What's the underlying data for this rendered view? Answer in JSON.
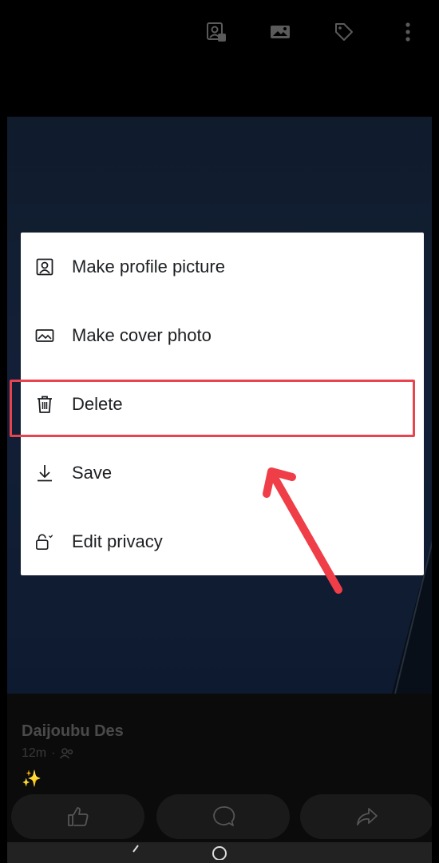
{
  "topbar": {
    "icons": [
      "profile-picture-icon",
      "cover-photo-icon",
      "tag-icon",
      "more-options-icon"
    ]
  },
  "menu": {
    "items": [
      {
        "label": "Make profile picture",
        "icon": "profile-frame-icon"
      },
      {
        "label": "Make cover photo",
        "icon": "landscape-image-icon"
      },
      {
        "label": "Delete",
        "icon": "trash-icon"
      },
      {
        "label": "Save",
        "icon": "download-icon"
      },
      {
        "label": "Edit privacy",
        "icon": "lock-icon"
      }
    ]
  },
  "post": {
    "author": "Daijoubu Des",
    "time": "12m",
    "separator": "·",
    "emoji": "✨"
  },
  "actions": [
    "like-icon",
    "comment-icon",
    "share-icon"
  ],
  "colors": {
    "highlight": "#e8434f",
    "arrow": "#ef3e47",
    "menu_bg": "#ffffff",
    "menu_text": "#1c1e21"
  }
}
